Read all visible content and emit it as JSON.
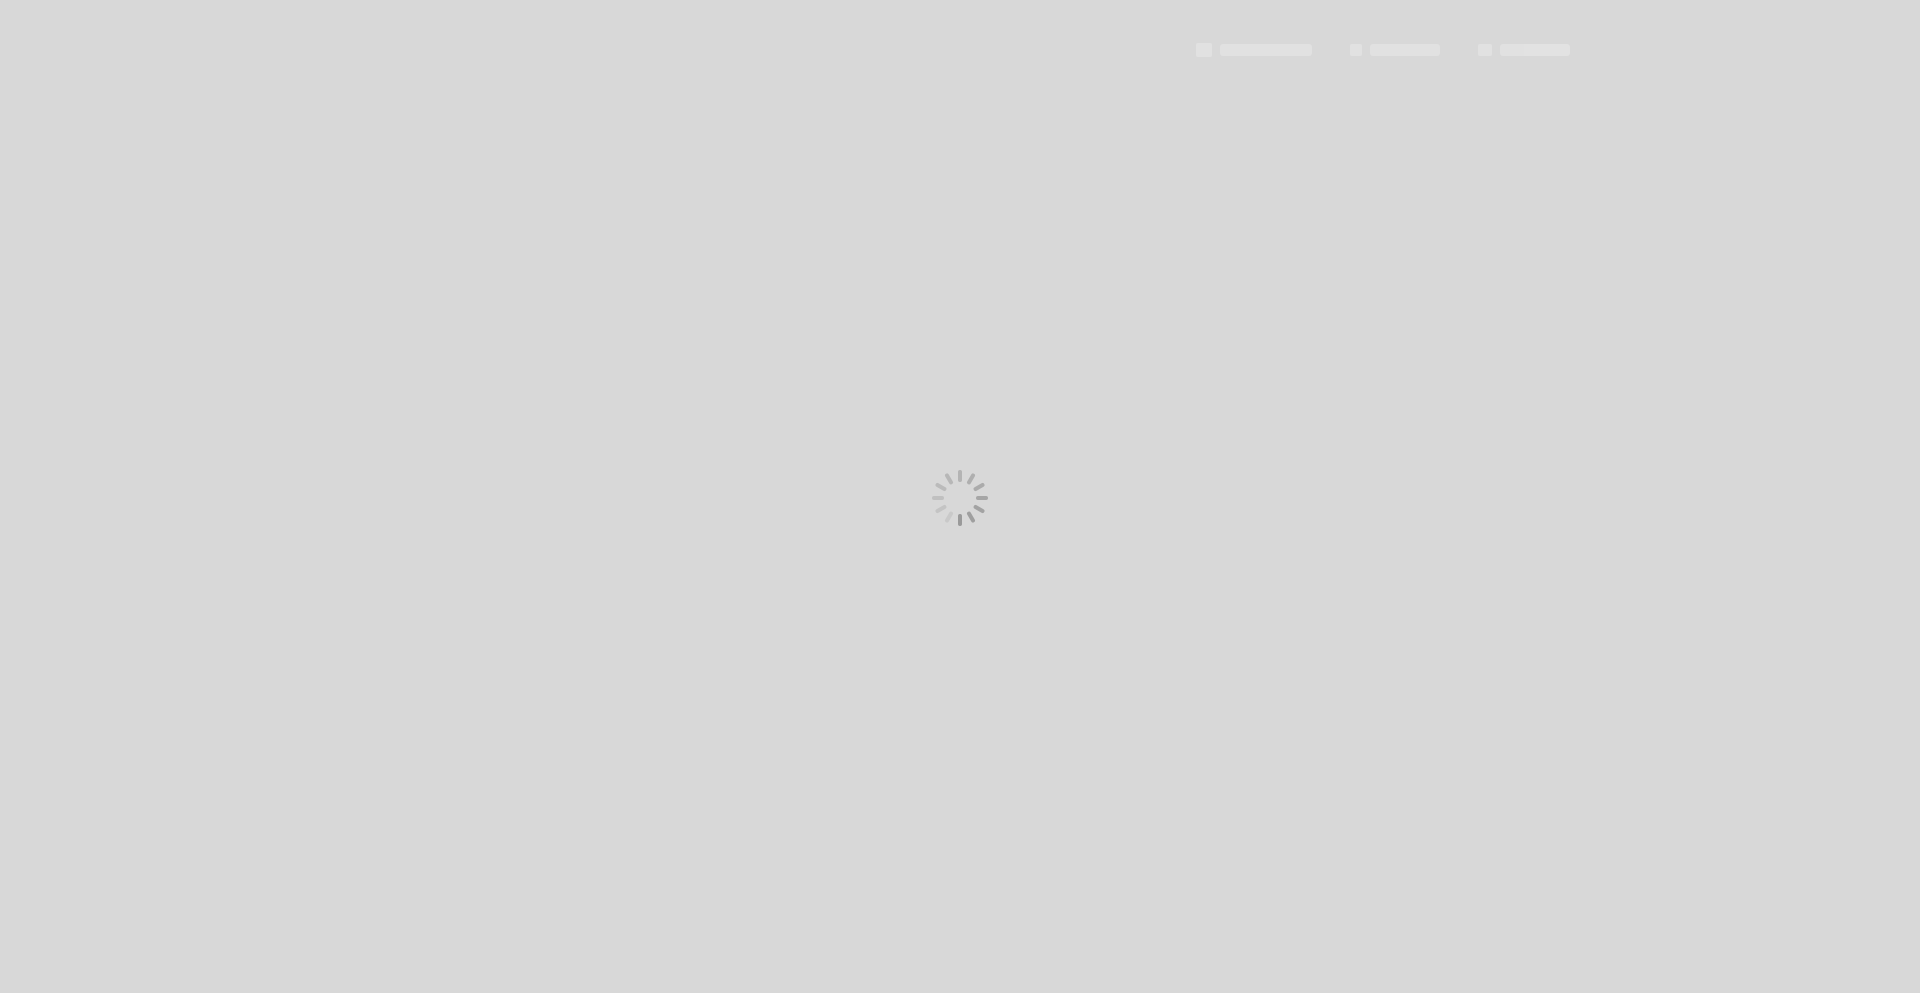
{
  "header": {
    "logo_alt": "",
    "nav_items": [
      {
        "label": "",
        "icon": "link-icon"
      },
      {
        "label": "",
        "icon": "grid-icon"
      }
    ]
  },
  "overlay": {
    "state": "loading",
    "icon": "spinner-icon",
    "spinner_color": "#9a9a9a",
    "background_color": "#d8d8d8"
  }
}
